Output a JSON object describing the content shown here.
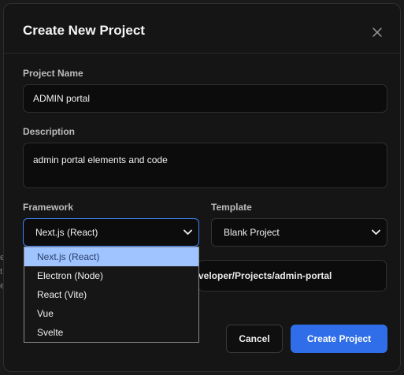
{
  "background": {
    "peek_lines": [
      "e",
      "t",
      "e"
    ]
  },
  "modal": {
    "title": "Create New Project",
    "close_icon": "close-icon"
  },
  "project_name": {
    "label": "Project Name",
    "value": "ADMIN portal"
  },
  "description": {
    "label": "Description",
    "value": "admin portal elements and code"
  },
  "framework": {
    "label": "Framework",
    "selected": "Next.js (React)",
    "options": [
      "Next.js (React)",
      "Electron (Node)",
      "React (Vite)",
      "Vue",
      "Svelte"
    ],
    "highlighted_index": 0
  },
  "template": {
    "label": "Template",
    "selected": "Blank Project"
  },
  "location": {
    "value": "veloper/Projects/admin-portal"
  },
  "buttons": {
    "cancel": "Cancel",
    "create": "Create Project"
  },
  "colors": {
    "accent": "#2f6ee8",
    "focus_border": "#3b82f6",
    "option_highlight": "#9fc4ff",
    "modal_bg": "#151515"
  }
}
